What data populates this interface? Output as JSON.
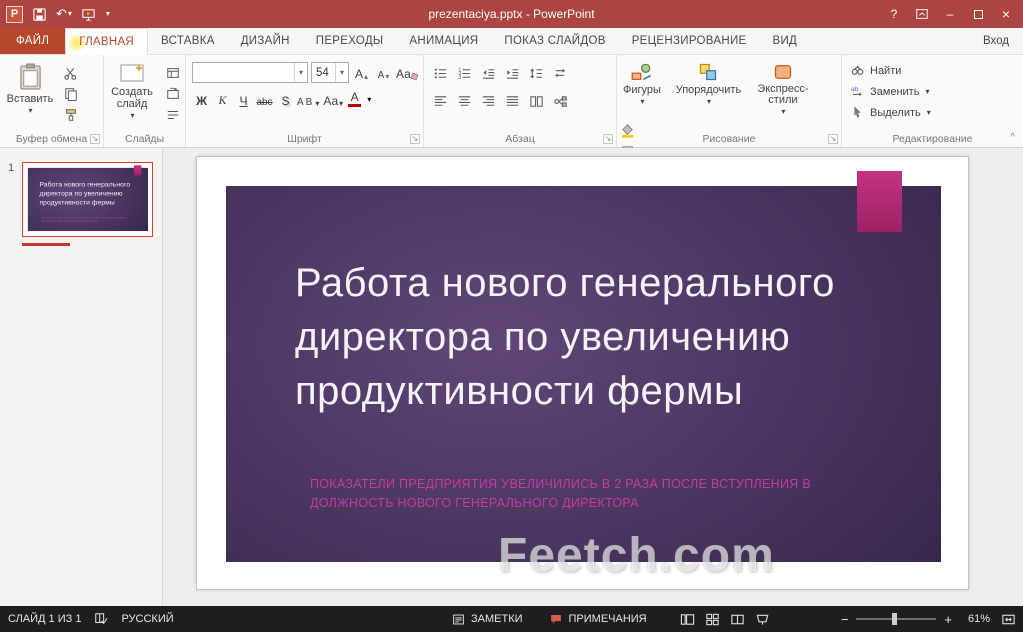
{
  "titlebar": {
    "title": "prezentaciya.pptx - PowerPoint"
  },
  "icons": {
    "caret": "▾",
    "caret_up": "▴",
    "close": "×",
    "minimize": "–",
    "help": "?",
    "app_letter": "P",
    "launcher": "↘",
    "collapse": "^",
    "zoom_out": "−",
    "zoom_in": "+",
    "undo": "↶"
  },
  "tabs": {
    "file": "ФАЙЛ",
    "items": [
      "ГЛАВНАЯ",
      "ВСТАВКА",
      "ДИЗАЙН",
      "ПЕРЕХОДЫ",
      "АНИМАЦИЯ",
      "ПОКАЗ СЛАЙДОВ",
      "РЕЦЕНЗИРОВАНИЕ",
      "ВИД"
    ],
    "sign_in": "Вход"
  },
  "ribbon": {
    "clipboard": {
      "label": "Буфер обмена",
      "paste": "Вставить"
    },
    "slides": {
      "label": "Слайды",
      "new_slide": "Создать слайд"
    },
    "font": {
      "label": "Шрифт",
      "font_name": "",
      "font_size": "54",
      "bold": "Ж",
      "italic": "К",
      "underline": "Ч",
      "strike": "abc",
      "shadow": "S",
      "spacing": "АВ",
      "case_btn": "Аа",
      "color_letter": "А",
      "grow": "А",
      "shrink": "А"
    },
    "paragraph": {
      "label": "Абзац"
    },
    "drawing": {
      "label": "Рисование",
      "shapes": "Фигуры",
      "arrange": "Упорядочить",
      "quick_styles": "Экспресс-стили"
    },
    "editing": {
      "label": "Редактирование",
      "find": "Найти",
      "replace": "Заменить",
      "select": "Выделить"
    }
  },
  "slide": {
    "number": "1",
    "title_lines": [
      "Работа нового генерального",
      "директора по увеличению",
      "продуктивности фермы"
    ],
    "subtitle": "ПОКАЗАТЕЛИ ПРЕДПРИЯТИЯ УВЕЛИЧИЛИСЬ В 2 РАЗА ПОСЛЕ ВСТУПЛЕНИЯ В ДОЛЖНОСТЬ НОВОГО ГЕНЕРАЛЬНОГО ДИРЕКТОРА",
    "watermark": "Feetch.com"
  },
  "statusbar": {
    "slide_indicator": "СЛАЙД 1 ИЗ 1",
    "language": "РУССКИЙ",
    "notes": "ЗАМЕТКИ",
    "comments": "ПРИМЕЧАНИЯ",
    "zoom_level": "61%"
  },
  "colors": {
    "chrome": "#AC4440",
    "accent": "#BE2E79",
    "subtitle_pink": "#C63AA2",
    "panel_dark": "#2F2142",
    "panel_light": "#5F4677"
  }
}
